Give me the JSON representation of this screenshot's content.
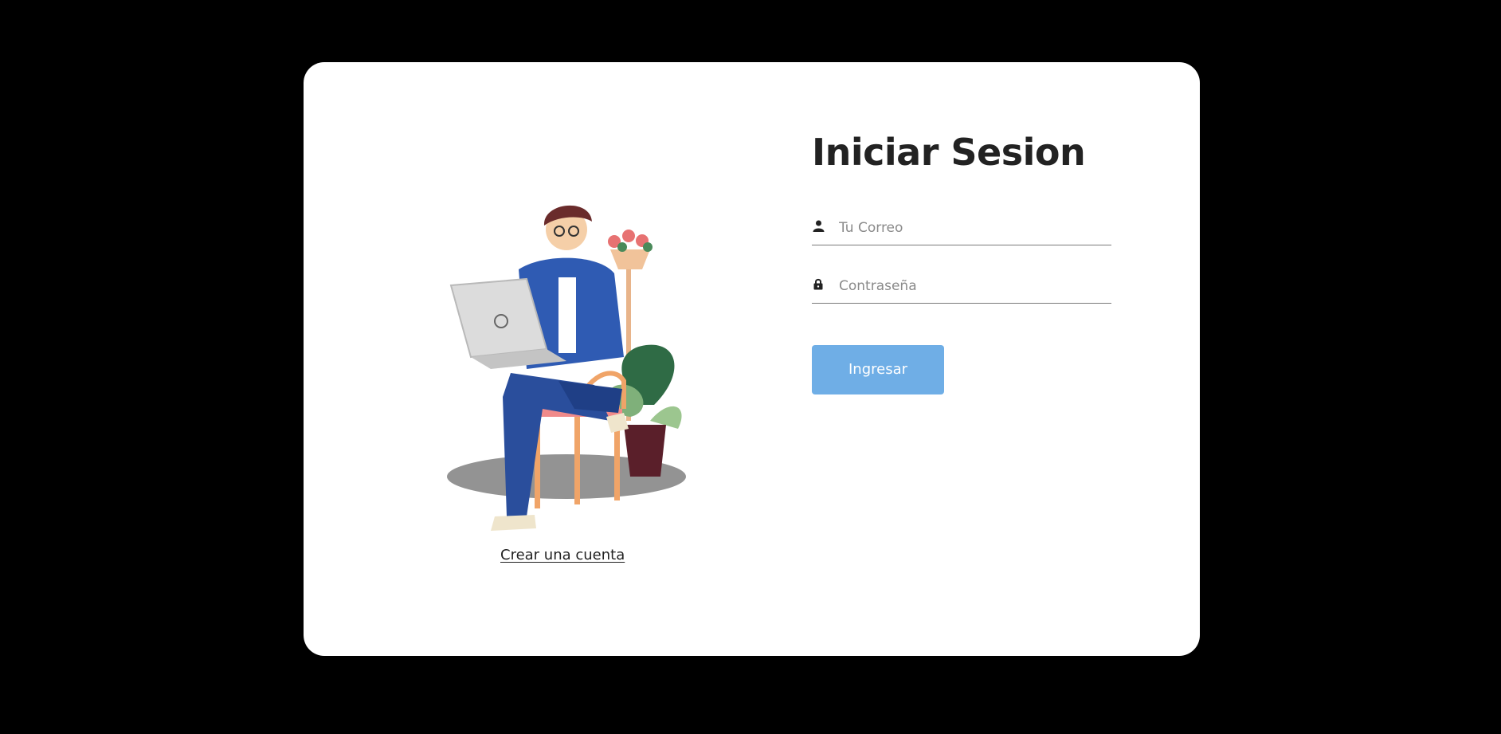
{
  "login": {
    "title": "Iniciar Sesion",
    "email": {
      "placeholder": "Tu Correo",
      "value": "",
      "icon": "user-icon"
    },
    "password": {
      "placeholder": "Contraseña",
      "value": "",
      "icon": "lock-icon"
    },
    "submit_label": "Ingresar",
    "create_account_label": "Crear una cuenta"
  },
  "colors": {
    "background": "#000000",
    "card": "#ffffff",
    "button": "#6faee6",
    "title": "#222222"
  }
}
